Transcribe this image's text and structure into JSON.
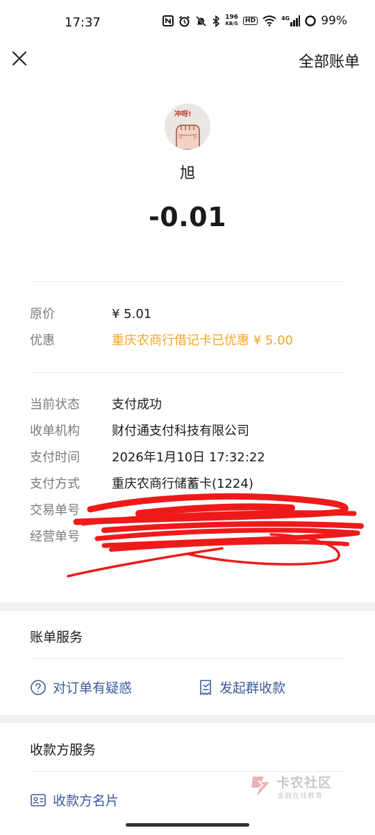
{
  "status_bar": {
    "time": "17:37",
    "speed_value": "196",
    "speed_unit": "KB/S",
    "hd": "HD",
    "network": "4G",
    "battery": "99%"
  },
  "nav": {
    "all_bills_label": "全部账单"
  },
  "payee": {
    "name": "旭",
    "amount": "-0.01",
    "avatar_text": "冲呀!"
  },
  "pricing": {
    "original_label": "原价",
    "original_value": "¥ 5.01",
    "discount_label": "优惠",
    "discount_value": "重庆农商行借记卡已优惠 ¥ 5.00"
  },
  "details": {
    "status_label": "当前状态",
    "status_value": "支付成功",
    "acquirer_label": "收单机构",
    "acquirer_value": "财付通支付科技有限公司",
    "time_label": "支付时间",
    "time_value": "2026年1月10日 17:32:22",
    "method_label": "支付方式",
    "method_value": "重庆农商行储蓄卡(1224)",
    "transaction_label": "交易单号",
    "merchant_order_label": "经营单号"
  },
  "bill_service": {
    "title": "账单服务",
    "question_label": "对订单有疑惑",
    "group_collect_label": "发起群收款"
  },
  "payee_service": {
    "title": "收款方服务",
    "card_label": "收款方名片"
  },
  "watermark": {
    "title": "卡农社区",
    "subtitle": "金融在线教育"
  },
  "colors": {
    "discount": "#f5a623",
    "link": "#3c5a9a",
    "scribble": "#ee1a1a"
  }
}
